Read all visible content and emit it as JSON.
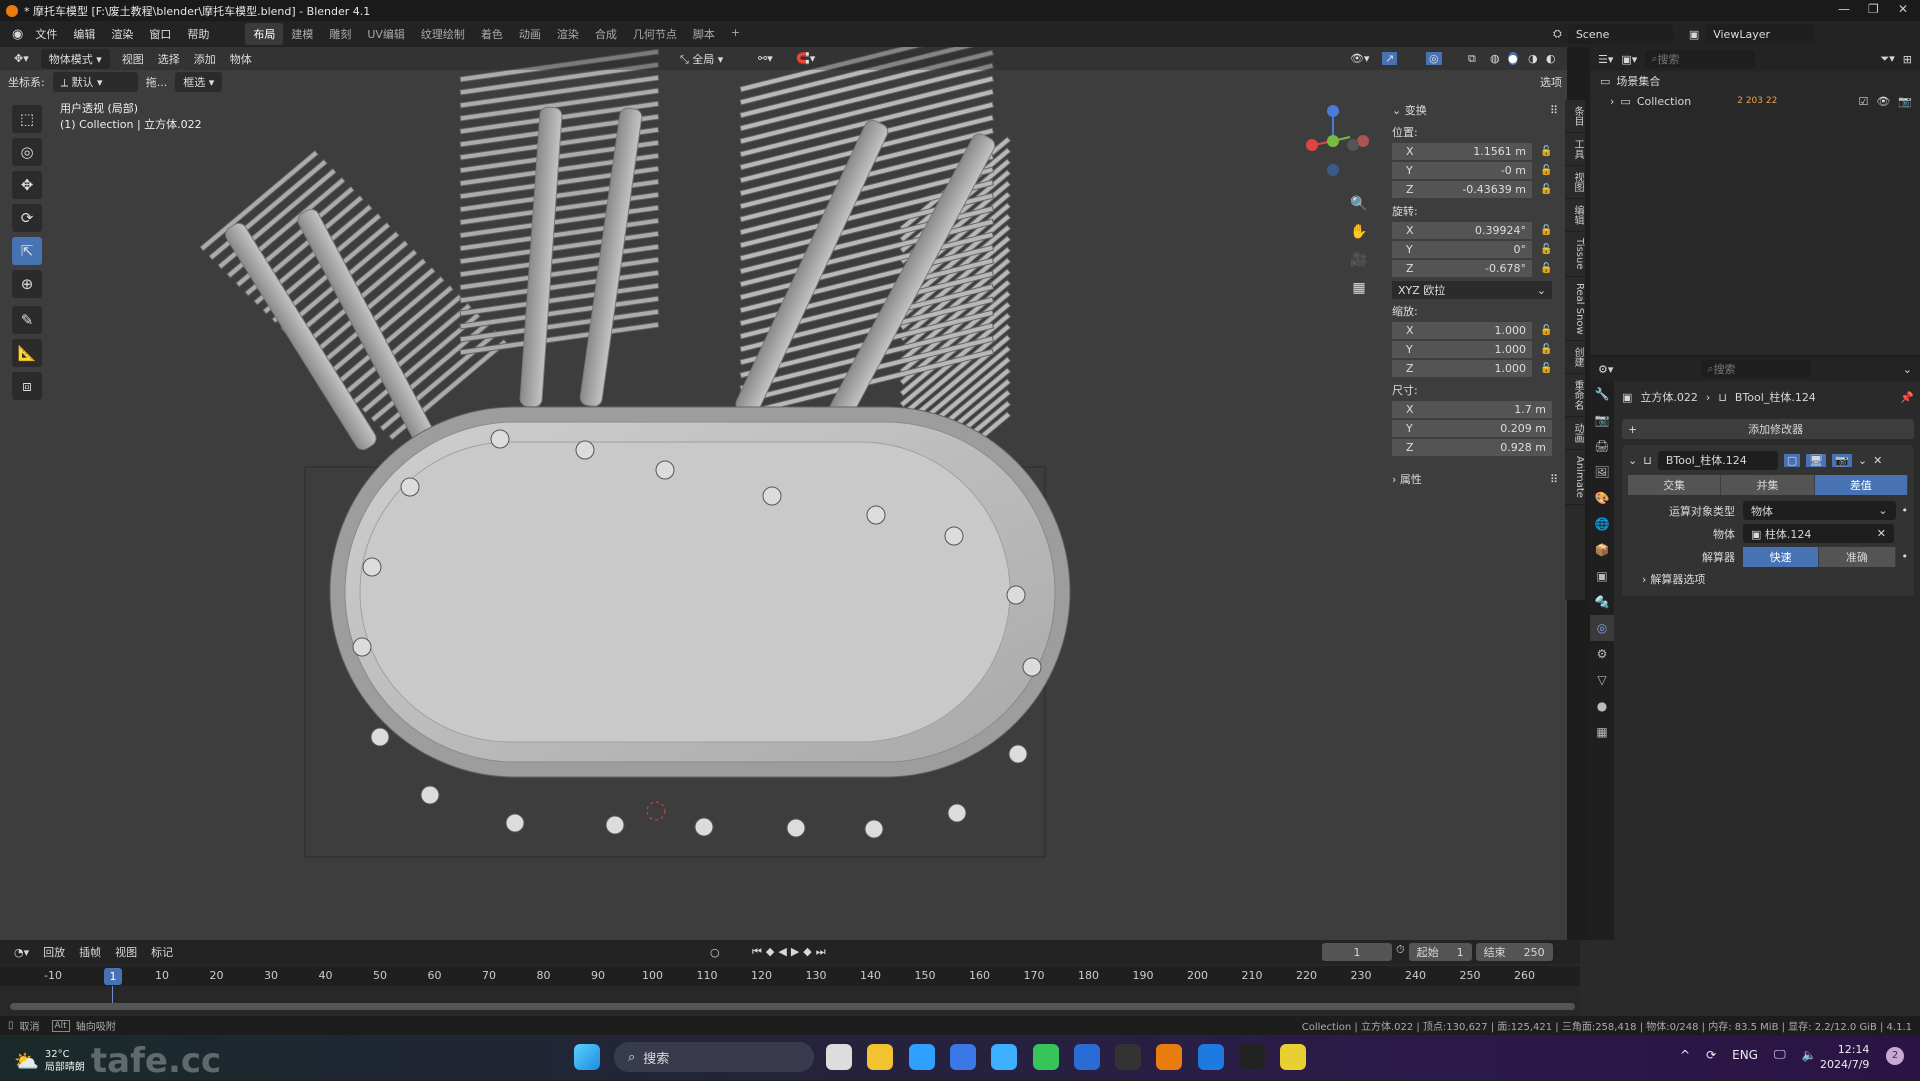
{
  "window": {
    "title": "* 摩托车模型 [F:\\废土教程\\blender\\摩托车模型.blend] - Blender 4.1",
    "min": "—",
    "max": "❐",
    "close": "✕"
  },
  "menu": {
    "items": [
      "文件",
      "编辑",
      "渲染",
      "窗口",
      "帮助"
    ],
    "workspaces": [
      "布局",
      "建模",
      "雕刻",
      "UV编辑",
      "纹理绘制",
      "着色",
      "动画",
      "渲染",
      "合成",
      "几何节点",
      "脚本",
      "+"
    ],
    "active_workspace": 0
  },
  "scene": {
    "scene": "Scene",
    "view_layer": "ViewLayer"
  },
  "viewport": {
    "header": {
      "mode": "物体模式",
      "menus": [
        "视图",
        "选择",
        "添加",
        "物体"
      ],
      "transform_orientation": "全局",
      "options": "选项"
    },
    "header2": {
      "coord_label": "坐标系:",
      "coord_value": "默认",
      "drag": "拖...",
      "select": "框选"
    },
    "info": {
      "view": "用户透视 (局部)",
      "collection": "(1) Collection | 立方体.022"
    },
    "tools": [
      "select-box",
      "cursor",
      "move",
      "rotate",
      "scale",
      "transform",
      "annotate",
      "measure",
      "add-cube"
    ],
    "active_tool": 4
  },
  "npanel": {
    "transform_title": "变换",
    "location_label": "位置:",
    "location": [
      {
        "axis": "X",
        "value": "1.1561 m"
      },
      {
        "axis": "Y",
        "value": "-0 m"
      },
      {
        "axis": "Z",
        "value": "-0.43639 m"
      }
    ],
    "rotation_label": "旋转:",
    "rotation": [
      {
        "axis": "X",
        "value": "0.39924°"
      },
      {
        "axis": "Y",
        "value": "0°"
      },
      {
        "axis": "Z",
        "value": "-0.678°"
      }
    ],
    "rotation_mode": "XYZ 欧拉",
    "scale_label": "缩放:",
    "scale": [
      {
        "axis": "X",
        "value": "1.000"
      },
      {
        "axis": "Y",
        "value": "1.000"
      },
      {
        "axis": "Z",
        "value": "1.000"
      }
    ],
    "dimensions_label": "尺寸:",
    "dimensions": [
      {
        "axis": "X",
        "value": "1.7 m"
      },
      {
        "axis": "Y",
        "value": "0.209 m"
      },
      {
        "axis": "Z",
        "value": "0.928 m"
      }
    ],
    "properties_title": "属性",
    "tabs": [
      "条目",
      "工具",
      "视图",
      "编辑",
      "Tissue",
      "Real Snow",
      "创建",
      "重命名",
      "动画",
      "Animate"
    ]
  },
  "outliner": {
    "search_placeholder": "搜索",
    "scene_collection": "场景集合",
    "collection": "Collection",
    "badge": "2 203 22"
  },
  "properties": {
    "search_placeholder": "搜索",
    "breadcrumb_object": "立方体.022",
    "breadcrumb_modifier": "BTool_柱体.124",
    "add_modifier": "添加修改器",
    "modifier_name": "BTool_柱体.124",
    "operations": [
      "交集",
      "并集",
      "差值"
    ],
    "active_operation": 2,
    "operand_type_label": "运算对象类型",
    "operand_type": "物体",
    "object_label": "物体",
    "object": "柱体.124",
    "solver_label": "解算器",
    "solvers": [
      "快速",
      "准确"
    ],
    "active_solver": 0,
    "solver_options": "解算器选项"
  },
  "timeline": {
    "menus": [
      "回放",
      "插帧",
      "视图",
      "标记"
    ],
    "current_frame": "1",
    "start_label": "起始",
    "start": "1",
    "end_label": "结束",
    "end": "250",
    "ticks": [
      "-10",
      "10",
      "20",
      "30",
      "40",
      "50",
      "60",
      "70",
      "80",
      "90",
      "100",
      "110",
      "120",
      "130",
      "140",
      "150",
      "160",
      "170",
      "180",
      "190",
      "200",
      "210",
      "220",
      "230",
      "240",
      "250",
      "260"
    ]
  },
  "statusbar": {
    "cancel": "取消",
    "alt_key": "Alt",
    "axis_snap": "轴向吸附",
    "stats": "Collection | 立方体.022 | 顶点:130,627 | 面:125,421 | 三角面:258,418 | 物体:0/248 | 内存: 83.5 MiB | 显存: 2.2/12.0 GiB | 4.1.1"
  },
  "taskbar": {
    "weather_temp": "32°C",
    "weather_desc": "局部晴朗",
    "watermark": "tafe.cc",
    "search": "搜索",
    "lang": "ENG",
    "time": "12:14",
    "date": "2024/7/9",
    "notif": "2"
  },
  "colors": {
    "accent": "#4772b3",
    "viewport_bg": "#3d3d3d",
    "panel_bg": "#2a2a2a"
  }
}
